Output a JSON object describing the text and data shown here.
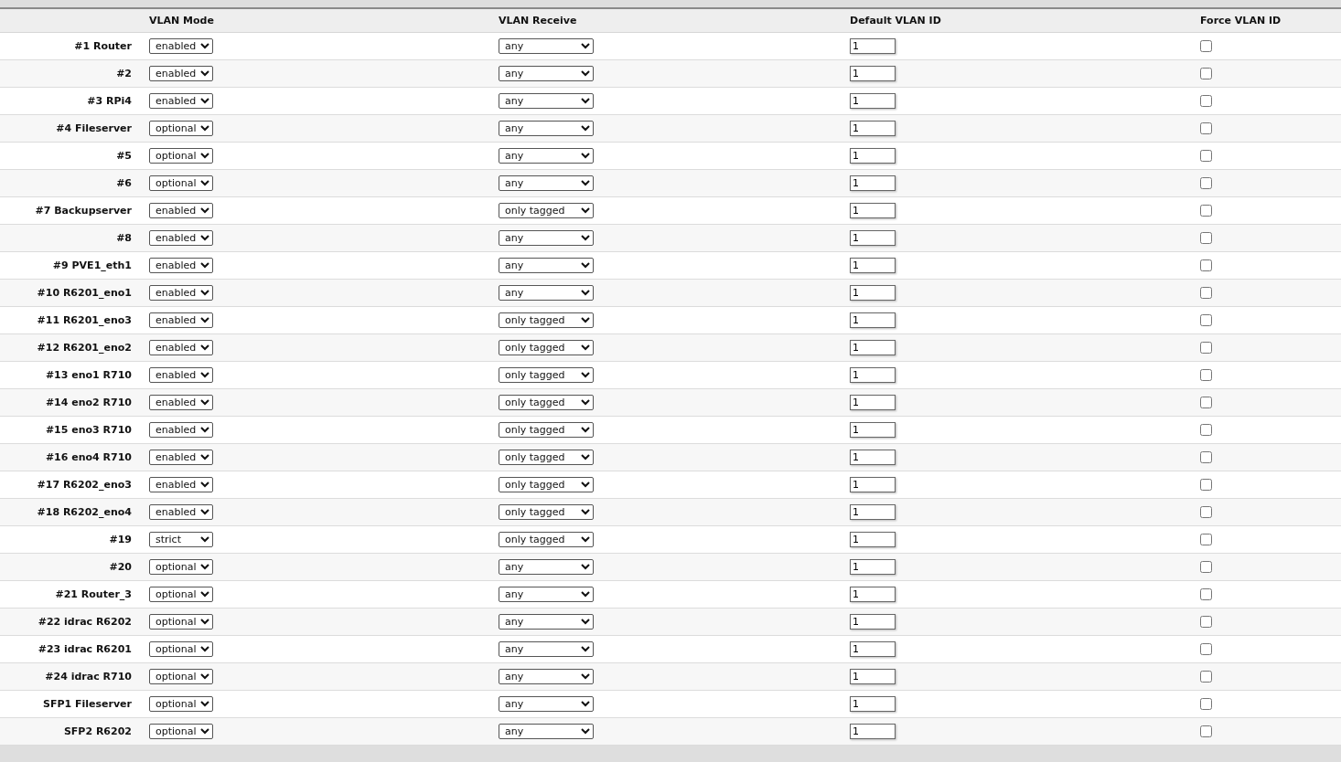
{
  "columns": [
    "VLAN Mode",
    "VLAN Receive",
    "Default VLAN ID",
    "Force VLAN ID"
  ],
  "rows": [
    {
      "label": "#1 Router",
      "vlan_mode": "enabled",
      "vlan_receive": "any",
      "default_vlan_id": "1",
      "force_vlan_id": false
    },
    {
      "label": "#2",
      "vlan_mode": "enabled",
      "vlan_receive": "any",
      "default_vlan_id": "1",
      "force_vlan_id": false
    },
    {
      "label": "#3 RPi4",
      "vlan_mode": "enabled",
      "vlan_receive": "any",
      "default_vlan_id": "1",
      "force_vlan_id": false
    },
    {
      "label": "#4 Fileserver",
      "vlan_mode": "optional",
      "vlan_receive": "any",
      "default_vlan_id": "1",
      "force_vlan_id": false
    },
    {
      "label": "#5",
      "vlan_mode": "optional",
      "vlan_receive": "any",
      "default_vlan_id": "1",
      "force_vlan_id": false
    },
    {
      "label": "#6",
      "vlan_mode": "optional",
      "vlan_receive": "any",
      "default_vlan_id": "1",
      "force_vlan_id": false
    },
    {
      "label": "#7 Backupserver",
      "vlan_mode": "enabled",
      "vlan_receive": "only tagged",
      "default_vlan_id": "1",
      "force_vlan_id": false
    },
    {
      "label": "#8",
      "vlan_mode": "enabled",
      "vlan_receive": "any",
      "default_vlan_id": "1",
      "force_vlan_id": false
    },
    {
      "label": "#9 PVE1_eth1",
      "vlan_mode": "enabled",
      "vlan_receive": "any",
      "default_vlan_id": "1",
      "force_vlan_id": false
    },
    {
      "label": "#10 R6201_eno1",
      "vlan_mode": "enabled",
      "vlan_receive": "any",
      "default_vlan_id": "1",
      "force_vlan_id": false
    },
    {
      "label": "#11 R6201_eno3",
      "vlan_mode": "enabled",
      "vlan_receive": "only tagged",
      "default_vlan_id": "1",
      "force_vlan_id": false
    },
    {
      "label": "#12 R6201_eno2",
      "vlan_mode": "enabled",
      "vlan_receive": "only tagged",
      "default_vlan_id": "1",
      "force_vlan_id": false
    },
    {
      "label": "#13 eno1 R710",
      "vlan_mode": "enabled",
      "vlan_receive": "only tagged",
      "default_vlan_id": "1",
      "force_vlan_id": false
    },
    {
      "label": "#14 eno2 R710",
      "vlan_mode": "enabled",
      "vlan_receive": "only tagged",
      "default_vlan_id": "1",
      "force_vlan_id": false
    },
    {
      "label": "#15 eno3 R710",
      "vlan_mode": "enabled",
      "vlan_receive": "only tagged",
      "default_vlan_id": "1",
      "force_vlan_id": false
    },
    {
      "label": "#16 eno4 R710",
      "vlan_mode": "enabled",
      "vlan_receive": "only tagged",
      "default_vlan_id": "1",
      "force_vlan_id": false
    },
    {
      "label": "#17 R6202_eno3",
      "vlan_mode": "enabled",
      "vlan_receive": "only tagged",
      "default_vlan_id": "1",
      "force_vlan_id": false
    },
    {
      "label": "#18 R6202_eno4",
      "vlan_mode": "enabled",
      "vlan_receive": "only tagged",
      "default_vlan_id": "1",
      "force_vlan_id": false
    },
    {
      "label": "#19",
      "vlan_mode": "strict",
      "vlan_receive": "only tagged",
      "default_vlan_id": "1",
      "force_vlan_id": false
    },
    {
      "label": "#20",
      "vlan_mode": "optional",
      "vlan_receive": "any",
      "default_vlan_id": "1",
      "force_vlan_id": false
    },
    {
      "label": "#21 Router_3",
      "vlan_mode": "optional",
      "vlan_receive": "any",
      "default_vlan_id": "1",
      "force_vlan_id": false
    },
    {
      "label": "#22 idrac R6202",
      "vlan_mode": "optional",
      "vlan_receive": "any",
      "default_vlan_id": "1",
      "force_vlan_id": false
    },
    {
      "label": "#23 idrac R6201",
      "vlan_mode": "optional",
      "vlan_receive": "any",
      "default_vlan_id": "1",
      "force_vlan_id": false
    },
    {
      "label": "#24 idrac R710",
      "vlan_mode": "optional",
      "vlan_receive": "any",
      "default_vlan_id": "1",
      "force_vlan_id": false
    },
    {
      "label": "SFP1 Fileserver",
      "vlan_mode": "optional",
      "vlan_receive": "any",
      "default_vlan_id": "1",
      "force_vlan_id": false
    },
    {
      "label": "SFP2 R6202",
      "vlan_mode": "optional",
      "vlan_receive": "any",
      "default_vlan_id": "1",
      "force_vlan_id": false
    }
  ]
}
